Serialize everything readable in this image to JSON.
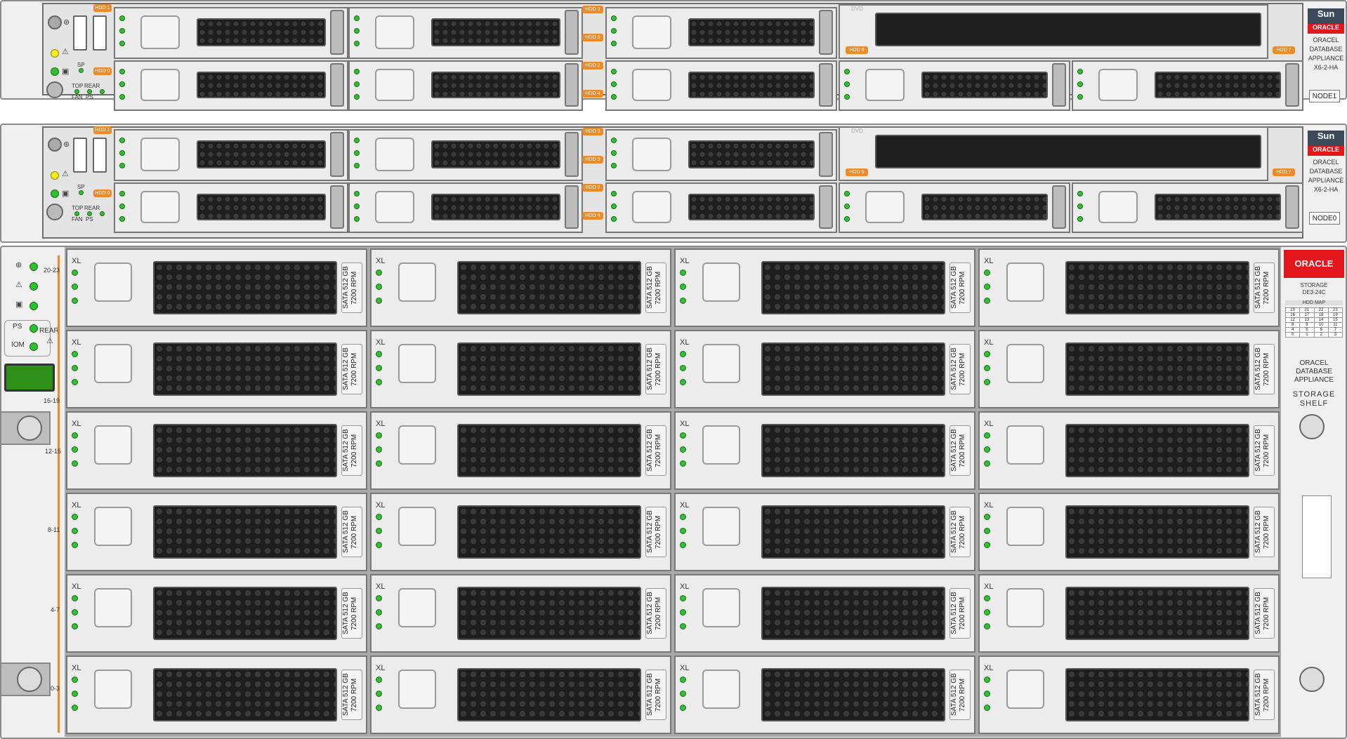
{
  "colors": {
    "accent": "#f08a24",
    "led_green": "#2ec02e",
    "led_yellow": "#f5ea1d",
    "oracle_red": "#e3161b",
    "grill": "#1e1e1e"
  },
  "servers": [
    {
      "node": "NODE1",
      "top_badges": {
        "hdd1": "HDD 1",
        "hdd3": "HDD 3",
        "hdd5": "HDD 5",
        "dvd": "DVD",
        "hdd6": "HDD 6",
        "hdd7": "HDD 7"
      },
      "bottom_badges": {
        "hdd0": "HDD 0",
        "hdd2": "HDD 2",
        "hdd4": "HDD 4"
      },
      "labels": {
        "sp": "SP",
        "top": "TOP",
        "rear": "REAR",
        "fan": "FAN",
        "ps": "PS"
      },
      "brand": {
        "sun": "Sun",
        "oracle": "ORACLE",
        "line1": "ORACEL",
        "line2": "DATABASE",
        "line3": "APPLIANCE",
        "line4": "X6-2-HA"
      }
    },
    {
      "node": "NODE0",
      "top_badges": {
        "hdd1": "HDD 1",
        "hdd3": "HDD 3",
        "hdd5": "HDD 5",
        "dvd": "DVD",
        "hdd6": "HDD 6",
        "hdd7": "HDD 7"
      },
      "bottom_badges": {
        "hdd0": "HDD 0",
        "hdd2": "HDD 2",
        "hdd4": "HDD 4"
      },
      "labels": {
        "sp": "SP",
        "top": "TOP",
        "rear": "REAR",
        "fan": "FAN",
        "ps": "PS"
      },
      "brand": {
        "sun": "Sun",
        "oracle": "ORACLE",
        "line1": "ORACEL",
        "line2": "DATABASE",
        "line3": "APPLIANCE",
        "line4": "X6-2-HA"
      }
    }
  ],
  "shelf": {
    "left": {
      "ps": "PS",
      "iom": "IOM",
      "rear": "REAR",
      "range_labels": [
        "20-23",
        "16-19",
        "12-15",
        "8-11",
        "4-7",
        "0-3"
      ]
    },
    "drive_label": {
      "xl": "XL",
      "line1": "SATA 512 GB",
      "line2": "7200 RPM"
    },
    "right": {
      "oracle": "ORACLE",
      "storage": "STORAGE",
      "model": "DE3-24C",
      "hdd_map_title": "HDD MAP",
      "hdd_map": [
        [
          "20",
          "21",
          "22",
          "23"
        ],
        [
          "16",
          "17",
          "18",
          "19"
        ],
        [
          "12",
          "13",
          "14",
          "15"
        ],
        [
          "8",
          "9",
          "10",
          "11"
        ],
        [
          "4",
          "5",
          "6",
          "7"
        ],
        [
          "0",
          "1",
          "2",
          "3"
        ]
      ],
      "text1": "ORACEL",
      "text2": "DATABASE",
      "text3": "APPLIANCE",
      "text4": "STORAGE",
      "text5": "SHELF"
    }
  }
}
